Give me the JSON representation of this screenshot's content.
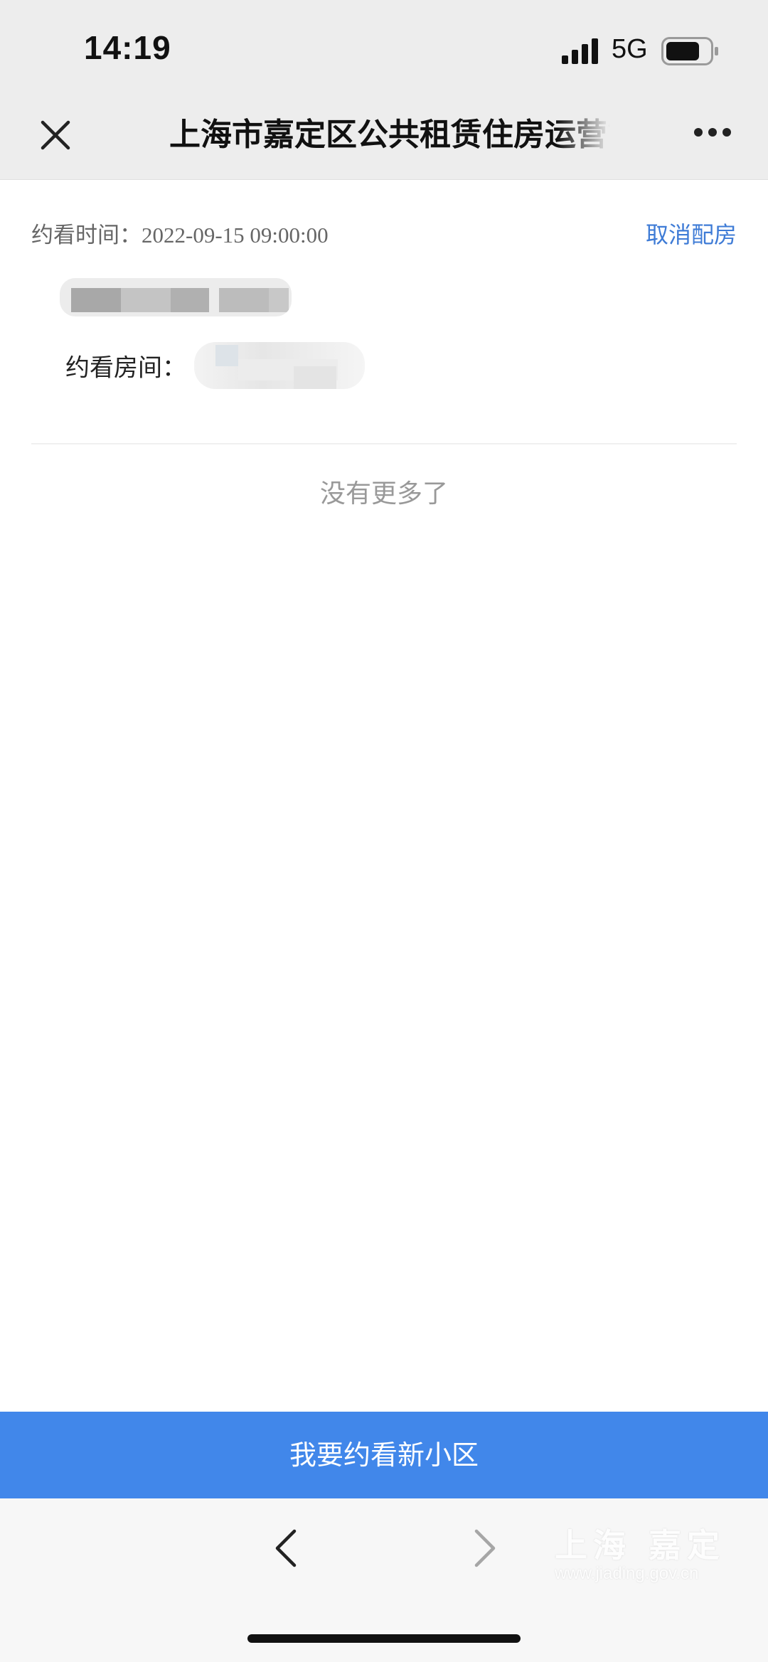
{
  "status": {
    "time": "14:19",
    "network": "5G"
  },
  "nav": {
    "title": "上海市嘉定区公共租赁住房运营管理"
  },
  "appointment": {
    "time_label": "约看时间：",
    "time_value": "2022-09-15 09:00:00",
    "cancel_label": "取消配房",
    "room_label": "约看房间："
  },
  "list_end_text": "没有更多了",
  "primary_button_label": "我要约看新小区",
  "watermark": {
    "title": "上海 嘉定",
    "url": "www.jiading.gov.cn"
  },
  "colors": {
    "accent": "#4187ea",
    "link": "#3e7bd6",
    "nav_bg": "#ededed"
  }
}
